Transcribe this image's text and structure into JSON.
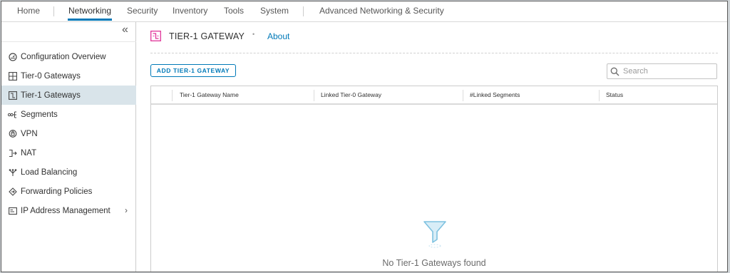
{
  "topnav": {
    "tabs": [
      "Home",
      "Networking",
      "Security",
      "Inventory",
      "Tools",
      "System",
      "Advanced Networking & Security"
    ],
    "active_tab": "Networking"
  },
  "sidebar": {
    "collapse_icon": "double-chevron-left-icon",
    "items": [
      {
        "label": "Configuration Overview",
        "icon": "overview-icon"
      },
      {
        "label": "Tier-0 Gateways",
        "icon": "tier0-gateway-icon"
      },
      {
        "label": "Tier-1 Gateways",
        "icon": "tier1-gateway-icon",
        "active": true
      },
      {
        "label": "Segments",
        "icon": "segments-icon"
      },
      {
        "label": "VPN",
        "icon": "vpn-icon"
      },
      {
        "label": "NAT",
        "icon": "nat-icon"
      },
      {
        "label": "Load Balancing",
        "icon": "load-balancing-icon"
      },
      {
        "label": "Forwarding Policies",
        "icon": "forwarding-policies-icon"
      },
      {
        "label": "IP Address Management",
        "icon": "ip-address-icon",
        "expandable": true
      }
    ]
  },
  "header": {
    "title": "TIER-1 GATEWAY",
    "separator": "•",
    "about_label": "About",
    "icon_color": "#e0349a"
  },
  "toolbar": {
    "add_label": "ADD TIER-1 GATEWAY",
    "search_placeholder": "Search"
  },
  "grid": {
    "columns": [
      "Tier-1 Gateway Name",
      "Linked Tier-0 Gateway",
      "#Linked Segments",
      "Status"
    ],
    "rows": [],
    "empty_message": "No Tier-1 Gateways found"
  },
  "colors": {
    "accent": "#0079b8",
    "active_row": "#d9e4ea",
    "empty_icon": "#7ec2e0"
  }
}
